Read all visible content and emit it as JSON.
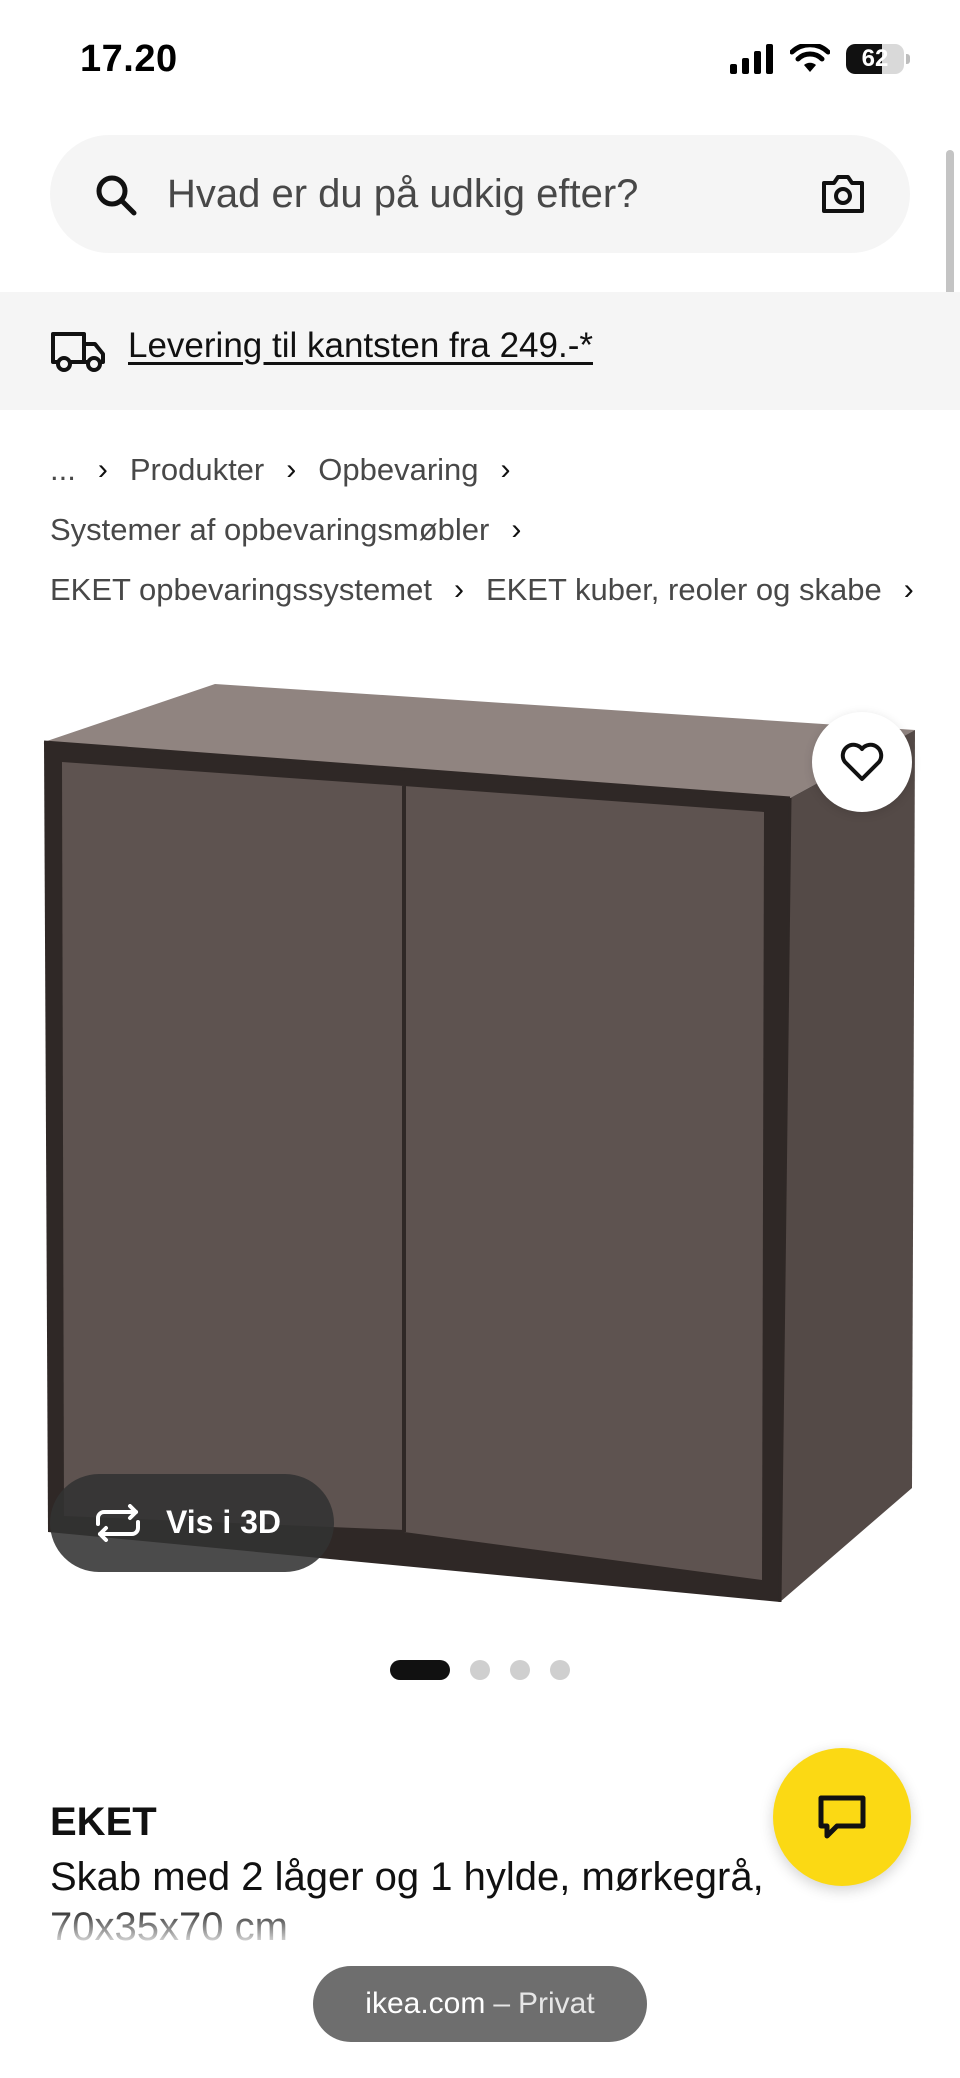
{
  "status_bar": {
    "time": "17.20",
    "battery": "62",
    "battery_level": 0.62
  },
  "search": {
    "placeholder": "Hvad er du på udkig efter?",
    "left_icon": "search-icon",
    "right_icon": "camera-icon"
  },
  "delivery": {
    "icon": "truck-icon",
    "link": "Levering til kantsten fra 249.-*"
  },
  "breadcrumb": {
    "rows": [
      [
        "...",
        "Produkter",
        "Opbevaring"
      ],
      [
        "Systemer af opbevaringsmøbler"
      ],
      [
        "EKET opbevaringssystemet",
        "EKET kuber, reoler og skabe"
      ]
    ],
    "separator": "›"
  },
  "product_image": {
    "colors": {
      "top": "#908480",
      "front": "#5e5350",
      "side": "#544a47",
      "edge": "#2f2826"
    },
    "favorite_icon": "heart-icon",
    "view3d_icon": "rotate-3d-icon",
    "view3d_label": "Vis i 3D"
  },
  "carousel": {
    "total": 4,
    "active_index": 0
  },
  "product": {
    "name": "EKET",
    "description": "Skab med 2 låger og 1 hylde, mørkegrå, 70x35x70 cm"
  },
  "chat": {
    "icon": "chat-icon",
    "color": "#fbd914"
  },
  "url_bar": {
    "domain": "ikea.com",
    "separator": "–",
    "mode": "Privat"
  }
}
